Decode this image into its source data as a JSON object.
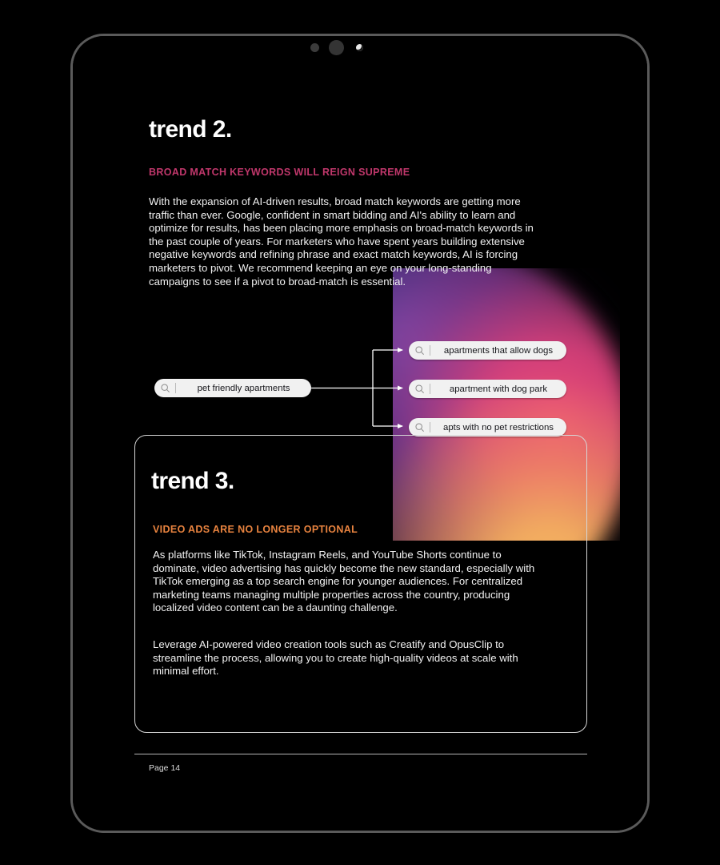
{
  "device": {
    "camera": {
      "dot_left": "camera-dot",
      "dot_center": "camera-lens",
      "dot_right": "ambient-light-sensor"
    }
  },
  "theme": {
    "background": "#000000",
    "frame_stroke": "#5a5a5a",
    "body_text": "#f2f2f2",
    "accent_pink": "#c0376b",
    "accent_orange": "#e8833f",
    "card_border": "#d6d6d6",
    "pill_background": "#f1f1f1",
    "pill_text": "#15151a",
    "connector_stroke": "#ffffff",
    "gradient_purple": "#7448aa",
    "gradient_magenta": "#e94978",
    "gradient_orange": "#fab660"
  },
  "trend2": {
    "title": "trend 2.",
    "eyebrow": "BROAD MATCH KEYWORDS WILL REIGN SUPREME",
    "body": "With the expansion of AI-driven results, broad match keywords are getting more traffic than ever. Google, confident in smart bidding and AI's ability to learn and optimize for results, has been placing more emphasis on broad-match keywords in the past couple of years. For marketers who have spent years building extensive negative keywords and refining phrase and exact match keywords, AI is forcing marketers to pivot. We recommend keeping an eye on your long-standing campaigns to see if a pivot to broad-match is essential."
  },
  "diagram": {
    "source_keyword": "pet friendly apartments",
    "variants": [
      "apartments that allow dogs",
      "apartment with dog park",
      "apts with no pet restrictions"
    ],
    "search_icon": "search-icon"
  },
  "trend3": {
    "title": "trend 3.",
    "eyebrow": "VIDEO ADS ARE NO LONGER OPTIONAL",
    "body_1": "As platforms like TikTok, Instagram Reels, and YouTube Shorts continue to dominate, video advertising has quickly become the new standard, especially with TikTok emerging as a top search engine for younger audiences. For centralized marketing teams managing multiple properties across the country, producing localized video content can be a daunting challenge.",
    "body_2": "Leverage AI-powered video creation tools such as Creatify and OpusClip to streamline the process, allowing you to create high-quality videos at scale with minimal effort."
  },
  "footer": {
    "page_label": "Page 14"
  }
}
